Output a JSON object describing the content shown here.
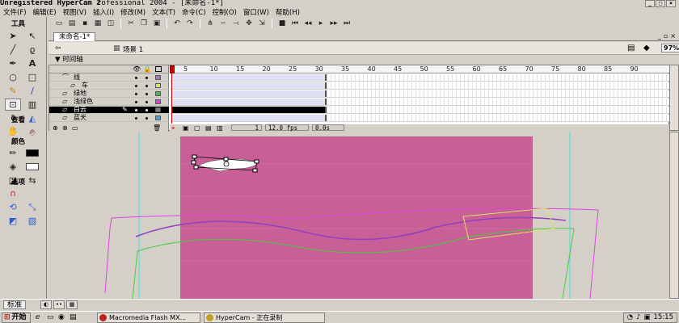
{
  "titlebar": {
    "capture_app": "Unregistered HyperCam 2",
    "app_title": "rofessional 2004 - [未命名-1*]"
  },
  "menu": [
    "文件(F)",
    "编辑(E)",
    "视图(V)",
    "插入(I)",
    "修改(M)",
    "文本(T)",
    "命令(C)",
    "控制(O)",
    "窗口(W)",
    "帮助(H)"
  ],
  "tools_panel": {
    "title": "工具",
    "view_title": "查看",
    "colors_title": "颜色",
    "options_title": "选项"
  },
  "document": {
    "tab": "未命名-1*",
    "scene": "场景 1",
    "zoom": "97%"
  },
  "timeline": {
    "title": "时间轴",
    "ruler": [
      "5",
      "10",
      "15",
      "20",
      "25",
      "30",
      "35",
      "40",
      "45",
      "50",
      "55",
      "60",
      "65",
      "70",
      "75",
      "80",
      "85",
      "90"
    ],
    "layers": [
      {
        "name": "线",
        "color": "#b070d0",
        "selected": false,
        "guide": true
      },
      {
        "name": "车",
        "color": "#e0e060",
        "selected": false,
        "guide": false
      },
      {
        "name": "绿地",
        "color": "#40c040",
        "selected": false,
        "guide": false
      },
      {
        "name": "浅绿色",
        "color": "#e040e0",
        "selected": false,
        "guide": false
      },
      {
        "name": "白云",
        "color": "#808080",
        "selected": true,
        "guide": false
      },
      {
        "name": "蓝天",
        "color": "#40a0e0",
        "selected": false,
        "guide": false
      }
    ],
    "status": {
      "frame": "1",
      "fps": "12.0 fps",
      "time": "0.0s"
    }
  },
  "panelbar": {
    "standard": "标准"
  },
  "taskbar": {
    "start": "开始",
    "tasks": [
      "Macromedia Flash MX...",
      "HyperCam - 正在录制"
    ],
    "clock": "15:15"
  },
  "colors": {
    "stage": "#c85f96",
    "guide_cyan": "#40e0e0"
  }
}
